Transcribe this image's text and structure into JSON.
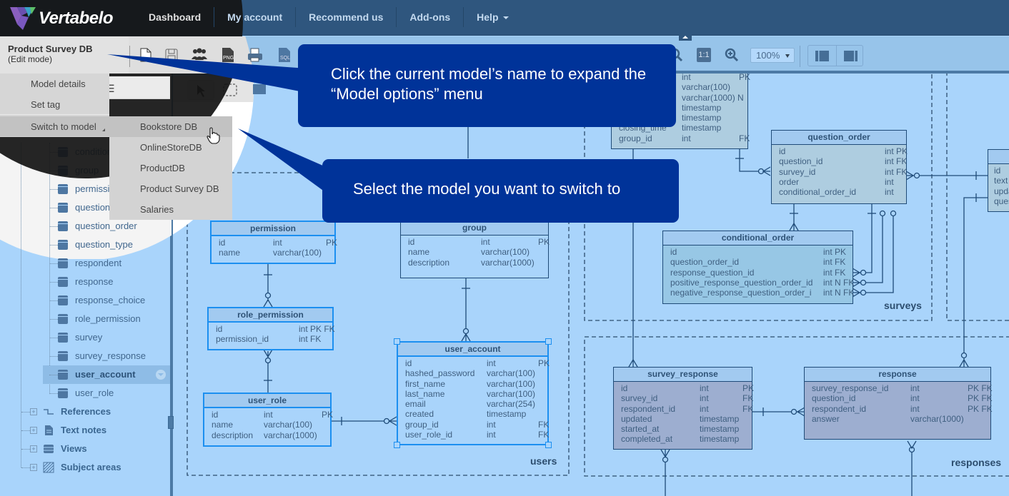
{
  "app": {
    "brand": "Vertabelo"
  },
  "nav": {
    "items": [
      {
        "label": "Dashboard"
      },
      {
        "label": "My account"
      },
      {
        "label": "Recommend us"
      },
      {
        "label": "Add-ons"
      },
      {
        "label": "Help"
      }
    ]
  },
  "model": {
    "name": "Product Survey DB",
    "mode": "(Edit mode)"
  },
  "toolbar": {
    "icons": [
      "new-document-icon",
      "save-icon",
      "share-users-icon",
      "export-png-icon",
      "print-icon",
      "export-sql-icon",
      "zoom-out-icon",
      "actual-size-icon",
      "zoom-in-icon"
    ],
    "actual_size_label": "1:1",
    "zoom_value": "100%"
  },
  "model_menu": {
    "items": [
      {
        "label": "Model details"
      },
      {
        "label": "Set tag"
      },
      {
        "label": "Switch to model"
      }
    ],
    "switch_submenu": [
      {
        "label": "Bookstore DB"
      },
      {
        "label": "OnlineStoreDB"
      },
      {
        "label": "ProductDB"
      },
      {
        "label": "Product Survey DB"
      },
      {
        "label": "Salaries"
      }
    ]
  },
  "tree": {
    "tables": [
      {
        "label": "condition"
      },
      {
        "label": "group"
      },
      {
        "label": "permissi"
      },
      {
        "label": "question"
      },
      {
        "label": "question_order"
      },
      {
        "label": "question_type"
      },
      {
        "label": "respondent"
      },
      {
        "label": "response"
      },
      {
        "label": "response_choice"
      },
      {
        "label": "role_permission"
      },
      {
        "label": "survey"
      },
      {
        "label": "survey_response"
      },
      {
        "label": "user_account",
        "selected": true
      },
      {
        "label": "user_role"
      }
    ],
    "sections": [
      {
        "label": "References"
      },
      {
        "label": "Text notes"
      },
      {
        "label": "Views"
      },
      {
        "label": "Subject areas"
      }
    ]
  },
  "callouts": {
    "first": "Click the current model’s name to expand the “Model options” menu",
    "second": "Select the model you want to switch to"
  },
  "areas": {
    "users": "users",
    "surveys": "surveys",
    "responses": "responses"
  },
  "er_tables": {
    "survey_partial": {
      "rows": [
        [
          "",
          "int",
          "PK"
        ],
        [
          "",
          "varchar(100)",
          ""
        ],
        [
          "",
          "varchar(1000) N",
          ""
        ],
        [
          "",
          "timestamp",
          ""
        ],
        [
          "",
          "timestamp",
          ""
        ],
        [
          "closing_time",
          "timestamp",
          ""
        ],
        [
          "group_id",
          "int",
          "FK"
        ]
      ]
    },
    "question_order": {
      "title": "question_order",
      "rows": [
        [
          "id",
          "int PK",
          ""
        ],
        [
          "question_id",
          "int FK",
          ""
        ],
        [
          "survey_id",
          "int FK",
          ""
        ],
        [
          "order",
          "int",
          ""
        ],
        [
          "conditional_order_id",
          "int",
          ""
        ]
      ]
    },
    "question_partial": {
      "rows": [
        [
          "id"
        ],
        [
          "text"
        ],
        [
          "upda"
        ],
        [
          "ques"
        ]
      ]
    },
    "conditional_order": {
      "title": "conditional_order",
      "rows": [
        [
          "id",
          "int PK",
          ""
        ],
        [
          "question_order_id",
          "int FK",
          ""
        ],
        [
          "response_question_id",
          "int FK",
          ""
        ],
        [
          "positive_response_question_order_id",
          "int N FK",
          ""
        ],
        [
          "negative_response_question_order_i",
          "int N FK",
          ""
        ]
      ]
    },
    "permission": {
      "title": "permission",
      "rows": [
        [
          "id",
          "int",
          "PK"
        ],
        [
          "name",
          "varchar(100)",
          ""
        ]
      ]
    },
    "group": {
      "title": "group",
      "rows": [
        [
          "id",
          "int",
          "PK"
        ],
        [
          "name",
          "varchar(100)",
          ""
        ],
        [
          "description",
          "varchar(1000)",
          ""
        ]
      ]
    },
    "role_permission": {
      "title": "role_permission",
      "rows": [
        [
          "id",
          "int PK FK",
          ""
        ],
        [
          "permission_id",
          "int FK",
          ""
        ]
      ]
    },
    "user_account": {
      "title": "user_account",
      "rows": [
        [
          "id",
          "int",
          "PK"
        ],
        [
          "hashed_password",
          "varchar(100)",
          ""
        ],
        [
          "first_name",
          "varchar(100)",
          ""
        ],
        [
          "last_name",
          "varchar(100)",
          ""
        ],
        [
          "email",
          "varchar(254)",
          ""
        ],
        [
          "created",
          "timestamp",
          ""
        ],
        [
          "group_id",
          "int",
          "FK"
        ],
        [
          "user_role_id",
          "int",
          "FK"
        ]
      ]
    },
    "user_role": {
      "title": "user_role",
      "rows": [
        [
          "id",
          "int",
          "PK"
        ],
        [
          "name",
          "varchar(100)",
          ""
        ],
        [
          "description",
          "varchar(1000)",
          ""
        ]
      ]
    },
    "survey_response": {
      "title": "survey_response",
      "rows": [
        [
          "id",
          "int",
          "PK"
        ],
        [
          "survey_id",
          "int",
          "FK"
        ],
        [
          "respondent_id",
          "int",
          "FK"
        ],
        [
          "updated",
          "timestamp",
          ""
        ],
        [
          "started_at",
          "timestamp",
          ""
        ],
        [
          "completed_at",
          "timestamp",
          ""
        ]
      ]
    },
    "response": {
      "title": "response",
      "rows": [
        [
          "survey_response_id",
          "int",
          "PK FK"
        ],
        [
          "question_id",
          "int",
          "PK FK"
        ],
        [
          "respondent_id",
          "int",
          "PK FK"
        ],
        [
          "answer",
          "varchar(1000)",
          ""
        ]
      ]
    }
  },
  "colors": {
    "nav_bg": "#2f567e",
    "canvas_bg": "#a9d4fb",
    "callout_bg": "#003399",
    "selected_border": "#1c8ff0"
  }
}
